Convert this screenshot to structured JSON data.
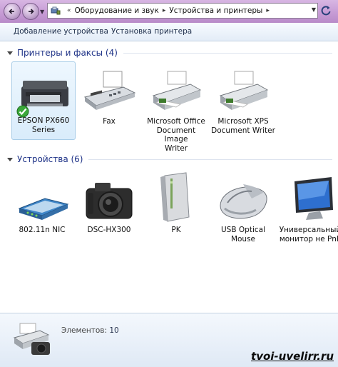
{
  "address_bar": {
    "crumbs": [
      "Оборудование и звук",
      "Устройства и принтеры"
    ]
  },
  "toolbar": {
    "add_device": "Добавление устройства",
    "add_printer": "Установка принтера"
  },
  "groups": [
    {
      "title": "Принтеры и факсы (4)",
      "items": [
        {
          "label": "EPSON PX660\nSeries",
          "icon": "inkjet-printer-icon",
          "default": true
        },
        {
          "label": "Fax",
          "icon": "fax-icon"
        },
        {
          "label": "Microsoft Office\nDocument Image\nWriter",
          "icon": "printer-icon"
        },
        {
          "label": "Microsoft XPS\nDocument Writer",
          "icon": "printer-icon"
        }
      ]
    },
    {
      "title": "Устройства (6)",
      "items": [
        {
          "label": "802.11n NIC",
          "icon": "network-adapter-icon"
        },
        {
          "label": "DSC-HX300",
          "icon": "camera-icon"
        },
        {
          "label": "PK",
          "icon": "computer-tower-icon"
        },
        {
          "label": "USB Optical\nMouse",
          "icon": "mouse-icon"
        },
        {
          "label": "Универсальный\nмонитор не PnP",
          "icon": "monitor-icon"
        }
      ]
    }
  ],
  "details": {
    "count_label": "Элементов:",
    "count_value": "10"
  },
  "watermark": "tvoi-uvelirr.ru"
}
